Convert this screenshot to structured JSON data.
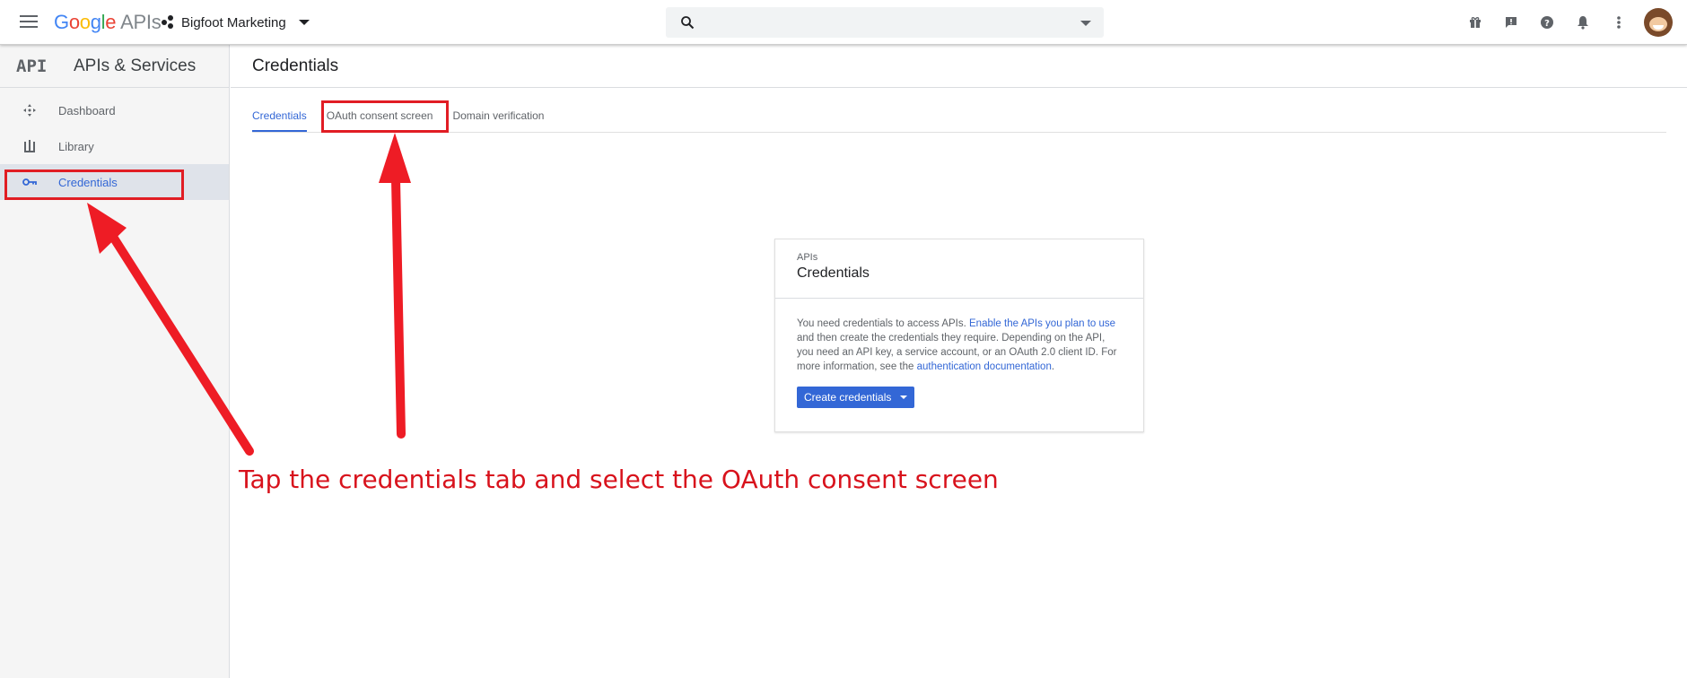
{
  "header": {
    "logo": {
      "letters": [
        "G",
        "o",
        "o",
        "g",
        "l",
        "e"
      ],
      "suffix": "APIs"
    },
    "project_name": "Bigfoot Marketing",
    "search": {
      "value": "",
      "placeholder": ""
    },
    "icons": [
      "menu-icon",
      "project-icon",
      "search-icon",
      "gift-icon",
      "feedback-icon",
      "help-icon",
      "notifications-icon",
      "more-vert-icon"
    ]
  },
  "sidebar": {
    "logo": "API",
    "title": "APIs & Services",
    "items": [
      {
        "label": "Dashboard",
        "icon": "dashboard-icon"
      },
      {
        "label": "Library",
        "icon": "library-icon"
      },
      {
        "label": "Credentials",
        "icon": "key-icon",
        "active": true
      }
    ]
  },
  "main": {
    "title": "Credentials",
    "tabs": [
      {
        "label": "Credentials",
        "active": true
      },
      {
        "label": "OAuth consent screen"
      },
      {
        "label": "Domain verification"
      }
    ],
    "card": {
      "eyebrow": "APIs",
      "title": "Credentials",
      "text_1": "You need credentials to access APIs. ",
      "link_1": "Enable the APIs you plan to use",
      "text_2": " and then create the credentials they require. Depending on the API, you need an API key, a service account, or an OAuth 2.0 client ID. For more information, see the ",
      "link_2": "authentication documentation",
      "text_3": ".",
      "button_label": "Create credentials"
    }
  },
  "annotation": {
    "text": "Tap the credentials tab and select the OAuth consent screen",
    "color": "#e11d24"
  },
  "colors": {
    "accent": "#3367d6",
    "sidebar_active_bg": "#dfe3ea",
    "annotation": "#e11d24"
  }
}
